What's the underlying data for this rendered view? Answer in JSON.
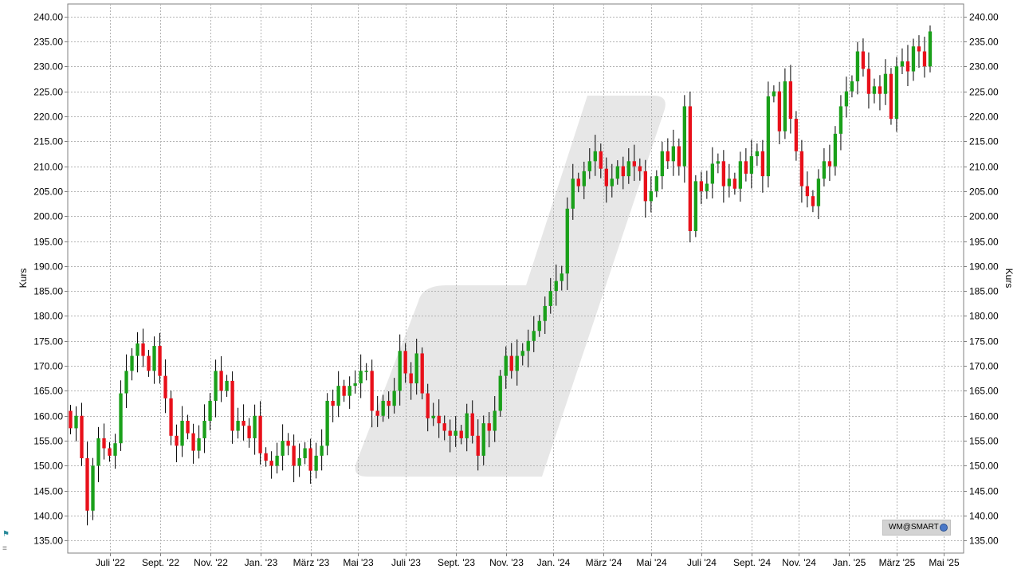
{
  "chart_data": {
    "type": "candlestick",
    "ylabel_left": "Kurs",
    "ylabel_right": "Kurs",
    "ylim": [
      132.5,
      242.5
    ],
    "yticks": [
      "240.00",
      "235.00",
      "230.00",
      "225.00",
      "220.00",
      "215.00",
      "210.00",
      "205.00",
      "200.00",
      "195.00",
      "190.00",
      "185.00",
      "180.00",
      "175.00",
      "170.00",
      "165.00",
      "160.00",
      "155.00",
      "150.00",
      "145.00",
      "140.00",
      "135.00"
    ],
    "xticks": [
      {
        "label": "Juli '22",
        "week": 7
      },
      {
        "label": "Sept. '22",
        "week": 16
      },
      {
        "label": "Nov. '22",
        "week": 25
      },
      {
        "label": "Jan. '23",
        "week": 34
      },
      {
        "label": "März '23",
        "week": 43
      },
      {
        "label": "Mai '23",
        "week": 51.5
      },
      {
        "label": "Juli '23",
        "week": 60
      },
      {
        "label": "Sept. '23",
        "week": 69
      },
      {
        "label": "Nov. '23",
        "week": 78
      },
      {
        "label": "Jan. '24",
        "week": 86.5
      },
      {
        "label": "März '24",
        "week": 95.5
      },
      {
        "label": "Mai '24",
        "week": 104
      },
      {
        "label": "Juli '24",
        "week": 113
      },
      {
        "label": "Sept. '24",
        "week": 122
      },
      {
        "label": "Nov. '24",
        "week": 130.5
      },
      {
        "label": "Jan. '25",
        "week": 139.5
      },
      {
        "label": "März '25",
        "week": 148
      },
      {
        "label": "Mai '25",
        "week": 156.5
      }
    ],
    "x_range_weeks": [
      -0.5,
      160
    ],
    "up_color": "#1aa01a",
    "down_color": "#e8101a",
    "grid": true,
    "weekly_closes": [
      157.5,
      160,
      151.5,
      141,
      150,
      155.5,
      153.5,
      152,
      154.5,
      164.5,
      169,
      172,
      174.5,
      172,
      169,
      174,
      168,
      163.5,
      156,
      154,
      159,
      156.5,
      153,
      155.5,
      159,
      163,
      169,
      165,
      167,
      157,
      159,
      158,
      155.5,
      160,
      152.5,
      151,
      150,
      152,
      155,
      154,
      150,
      151.5,
      153.5,
      149,
      152,
      154,
      163,
      162,
      166,
      164,
      166,
      166.5,
      169,
      169,
      161,
      160,
      163,
      162,
      165,
      173,
      168.5,
      166.5,
      172.5,
      164.5,
      159.5,
      160,
      158.5,
      157,
      156,
      157,
      155.5,
      160.5,
      156,
      152,
      158.5,
      157,
      161,
      168,
      172,
      169,
      172,
      173,
      175,
      177,
      179,
      182,
      185,
      187,
      188.5,
      201.5,
      207.5,
      206,
      209,
      211,
      213,
      209.5,
      206,
      207.5,
      210,
      208,
      211,
      210,
      209,
      203,
      205,
      208,
      213,
      211,
      214,
      210,
      222,
      197,
      207,
      205,
      206.5,
      210.5,
      211,
      206,
      207.5,
      205.5,
      211,
      208.5,
      212,
      213,
      208,
      224,
      225,
      217,
      227,
      219.5,
      213,
      206,
      204,
      202,
      207.5,
      211,
      210,
      216.5,
      222,
      225,
      227,
      233,
      229.5,
      224.5,
      226,
      224.5,
      228.5,
      219.5,
      230,
      231,
      229,
      234,
      233,
      230,
      237
    ],
    "notes": "weekly OHLC candles, July 2022 - May 2025; values read from axis, approx."
  },
  "badge": {
    "label": "WM@SMART"
  },
  "icons": {
    "badge_icon": "globe-icon",
    "side_icon": "dax-logo-icon"
  }
}
